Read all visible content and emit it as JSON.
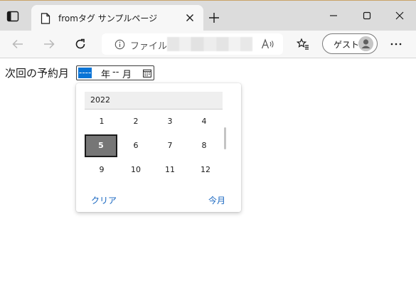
{
  "browser": {
    "tab": {
      "title": "fromタグ サンプルページ"
    },
    "address": {
      "security_label": "ファイル"
    },
    "profile": {
      "label": "ゲスト"
    }
  },
  "page": {
    "field_label": "次回の予約月",
    "month_input": {
      "year_placeholder": "----",
      "year_unit": "年",
      "month_placeholder": "--",
      "month_unit": "月"
    },
    "picker": {
      "year": "2022",
      "months": [
        "1",
        "2",
        "3",
        "4",
        "5",
        "6",
        "7",
        "8",
        "9",
        "10",
        "11",
        "12"
      ],
      "selected_month": "5",
      "clear_label": "クリア",
      "this_month_label": "今月"
    }
  }
}
